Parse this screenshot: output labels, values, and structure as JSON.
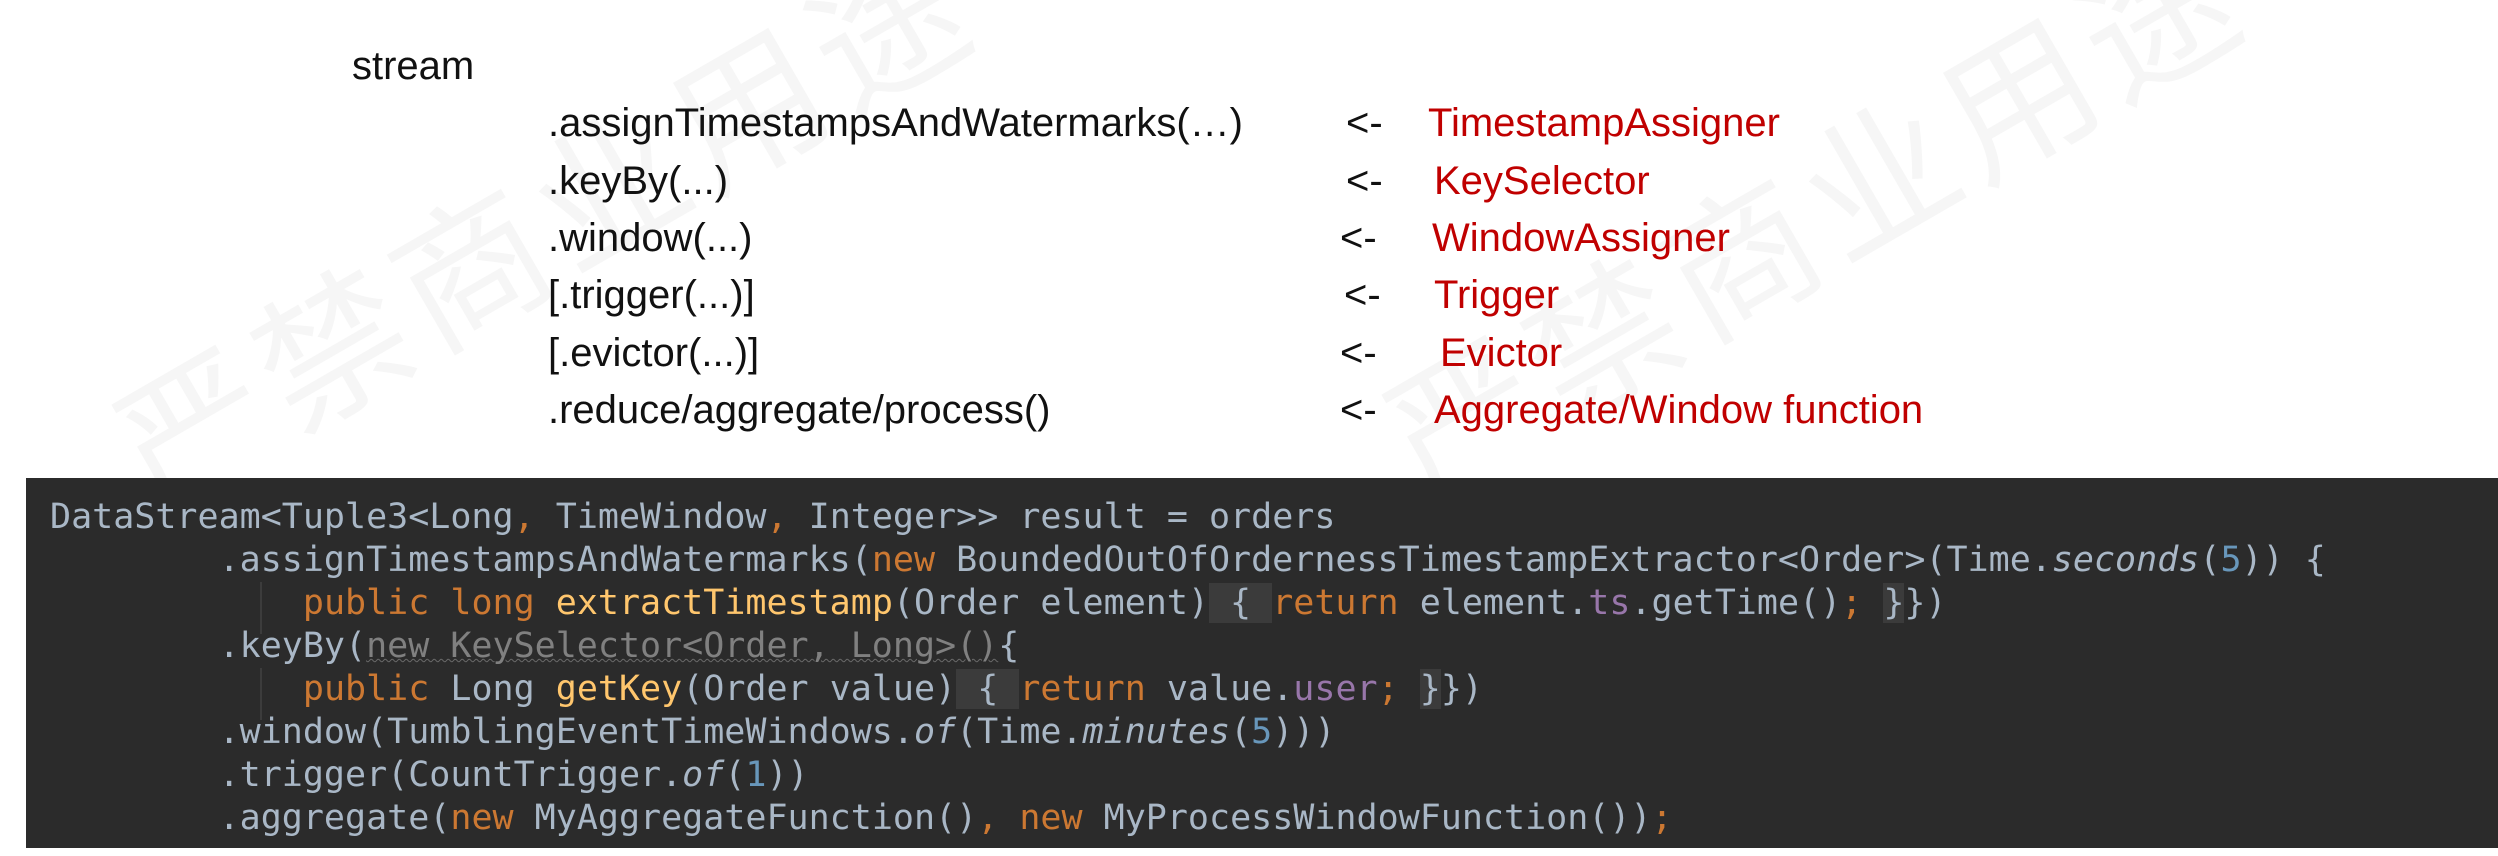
{
  "watermark": "严禁商业用途",
  "pipeline": {
    "root": "stream",
    "arrow": "<-",
    "rows": [
      {
        "call": ".assignTimestampsAndWatermarks(…)",
        "target": "TimestampAssigner"
      },
      {
        "call": ".keyBy(...)",
        "target": "KeySelector"
      },
      {
        "call": ".window(...)",
        "target": "WindowAssigner"
      },
      {
        "call": "[.trigger(...)]",
        "target": "Trigger"
      },
      {
        "call": "[.evictor(...)]",
        "target": "Evictor"
      },
      {
        "call": ".reduce/aggregate/process()",
        "target": "Aggregate/Window function"
      }
    ]
  },
  "code": {
    "l1": {
      "a": "DataStream<Tuple3<Long",
      "b": ", ",
      "c": "TimeWindow",
      "d": ", ",
      "e": "Integer>> result = orders"
    },
    "l2": {
      "a": "        .assignTimestampsAndWatermarks(",
      "b": "new ",
      "c": "BoundedOutOfOrdernessTimestampExtractor<Order>(Time.",
      "d": "seconds",
      "e": "(",
      "f": "5",
      "g": ")) {"
    },
    "l3": {
      "a": "            ",
      "b": "public long ",
      "c": "extractTimestamp",
      "d": "(Order element)",
      "e": " { ",
      "f": "return ",
      "g": "element.",
      "h": "ts",
      "i": ".getTime()",
      "j": "; ",
      "k": "}",
      "l": "})"
    },
    "l4": {
      "a": "        .keyBy(",
      "b": "new KeySelector<Order, Long>()",
      "c": "{"
    },
    "l5": {
      "a": "            ",
      "b": "public ",
      "c": "Long ",
      "d": "getKey",
      "e": "(Order value)",
      "f": " { ",
      "g": "return ",
      "h": "value.",
      "i": "user",
      "j": "; ",
      "k": "}",
      "l": "})"
    },
    "l6": {
      "a": "        .window(TumblingEventTimeWindows.",
      "b": "of",
      "c": "(Time.",
      "d": "minutes",
      "e": "(",
      "f": "5",
      "g": ")))"
    },
    "l7": {
      "a": "        .trigger(CountTrigger.",
      "b": "of",
      "c": "(",
      "d": "1",
      "e": "))"
    },
    "l8": {
      "a": "        .aggregate(",
      "b": "new ",
      "c": "MyAggregateFunction()",
      "d": ", ",
      "e": "new ",
      "f": "MyProcessWindowFunction())",
      "g": ";"
    }
  },
  "colors": {
    "target_red": "#c00000",
    "code_bg": "#2b2b2b",
    "keyword": "#cc7832",
    "method_decl": "#ffc66d",
    "number": "#6897bb",
    "field": "#9876aa",
    "plain": "#a9b7c6"
  }
}
